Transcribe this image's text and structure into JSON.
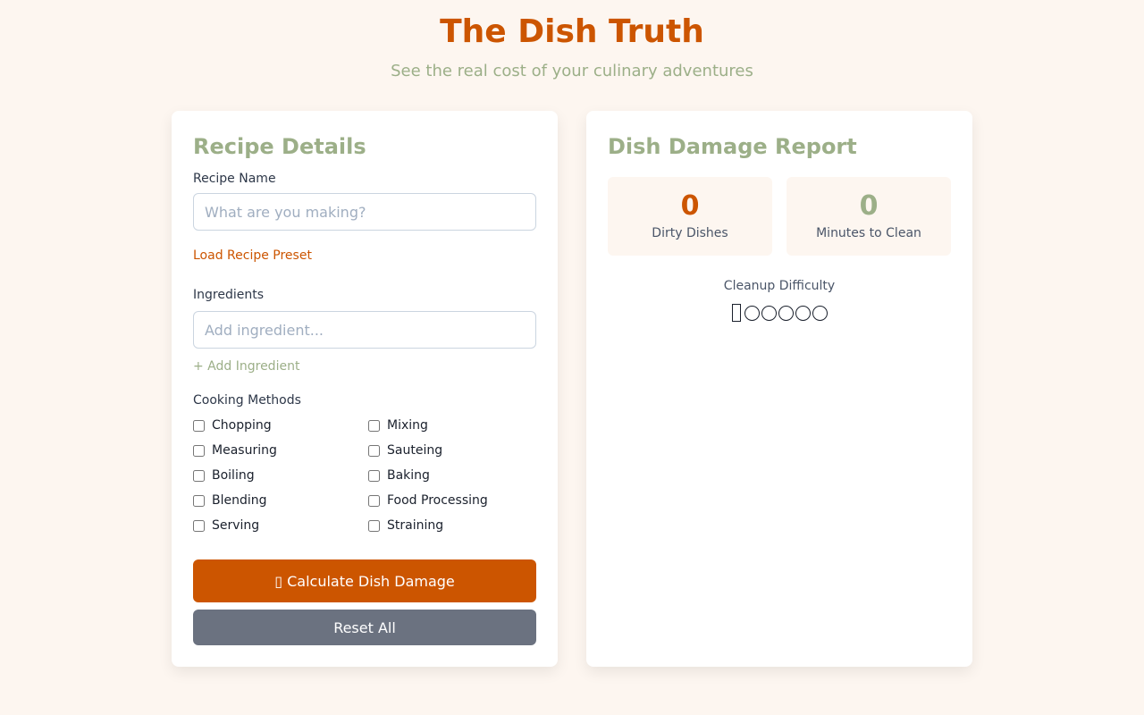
{
  "header": {
    "title": "The Dish Truth",
    "subtitle": "See the real cost of your culinary adventures"
  },
  "recipe_panel": {
    "title": "Recipe Details",
    "recipe_name_label": "Recipe Name",
    "recipe_name_value": "",
    "recipe_name_placeholder": "What are you making?",
    "load_preset_label": "Load Recipe Preset",
    "ingredients_label": "Ingredients",
    "ingredient_value": "",
    "ingredient_placeholder": "Add ingredient...",
    "add_ingredient_label": "+ Add Ingredient",
    "methods_label": "Cooking Methods",
    "methods": [
      {
        "label": "Chopping",
        "checked": false
      },
      {
        "label": "Mixing",
        "checked": false
      },
      {
        "label": "Measuring",
        "checked": false
      },
      {
        "label": "Sauteing",
        "checked": false
      },
      {
        "label": "Boiling",
        "checked": false
      },
      {
        "label": "Baking",
        "checked": false
      },
      {
        "label": "Blending",
        "checked": false
      },
      {
        "label": "Food Processing",
        "checked": false
      },
      {
        "label": "Serving",
        "checked": false
      },
      {
        "label": "Straining",
        "checked": false
      }
    ],
    "calculate_label": "▯ Calculate Dish Damage",
    "reset_label": "Reset All"
  },
  "report_panel": {
    "title": "Dish Damage Report",
    "dirty_dishes_value": "0",
    "dirty_dishes_label": "Dirty Dishes",
    "minutes_value": "0",
    "minutes_label": "Minutes to Clean",
    "difficulty_label": "Cleanup Difficulty",
    "difficulty_rating": 0,
    "difficulty_max": 5
  },
  "colors": {
    "accent": "#cc5500",
    "sage": "#9caf88",
    "background": "#fdf6f0",
    "secondary_button": "#6b7280"
  }
}
